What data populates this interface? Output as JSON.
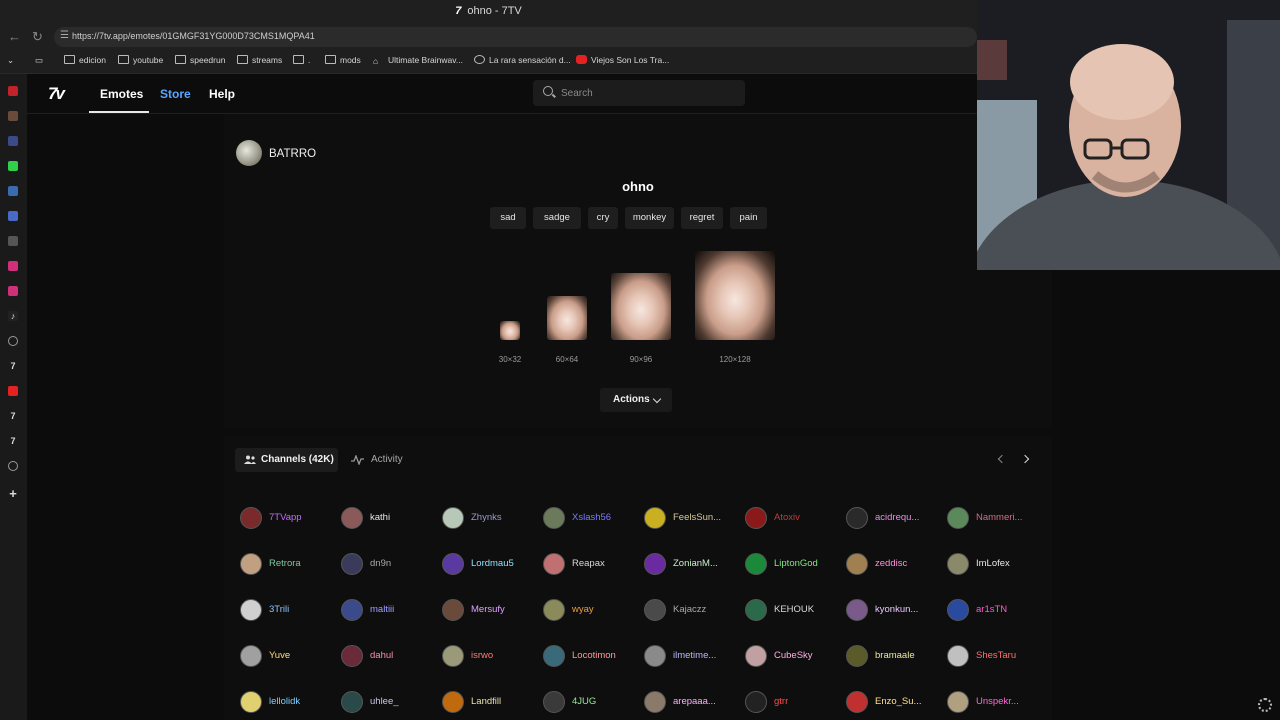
{
  "browser": {
    "window_title": "ohno - 7TV",
    "url": "https://7tv.app/emotes/01GMGF31YG000D73CMS1MQPA41",
    "bookmarks": [
      {
        "label": "edicion",
        "icon": "folder-icon"
      },
      {
        "label": "youtube",
        "icon": "folder-icon"
      },
      {
        "label": "speedrun",
        "icon": "folder-icon"
      },
      {
        "label": "streams",
        "icon": "folder-icon"
      },
      {
        "label": ".",
        "icon": "folder-icon"
      },
      {
        "label": "mods",
        "icon": "folder-icon"
      },
      {
        "label": "Ultimate Brainwav...",
        "icon": "mods-icon"
      },
      {
        "label": "La rara sensación d...",
        "icon": "globe-icon"
      },
      {
        "label": "Viejos Son Los Tra...",
        "icon": "youtube-icon"
      }
    ]
  },
  "site": {
    "logo": "7v",
    "nav": {
      "emotes": "Emotes",
      "store": "Store",
      "help": "Help"
    },
    "search_placeholder": "Search"
  },
  "emote": {
    "owner": "BATRRO",
    "name": "ohno",
    "tags": [
      "sad",
      "sadge",
      "cry",
      "monkey",
      "regret",
      "pain"
    ],
    "sizes": [
      "30×32",
      "60×64",
      "90×96",
      "120×128"
    ],
    "actions_label": "Actions"
  },
  "channels": {
    "tab_channels": "Channels (42K)",
    "tab_activity": "Activity",
    "list": [
      {
        "name": "7TVapp",
        "color": "#c66bff"
      },
      {
        "name": "kathi",
        "color": "#e8e8e8"
      },
      {
        "name": "Zhynks",
        "color": "#9a9ad6"
      },
      {
        "name": "Xslash56",
        "color": "#7b7bff"
      },
      {
        "name": "FeelsSun...",
        "color": "#d8c89a"
      },
      {
        "name": "Atoxiv",
        "color": "#c33a3a"
      },
      {
        "name": "acidrequ...",
        "color": "#e890e8"
      },
      {
        "name": "Nammeri...",
        "color": "#d06e88"
      },
      {
        "name": "Retrora",
        "color": "#7fc8a0"
      },
      {
        "name": "dn9n",
        "color": "#aaaaaa"
      },
      {
        "name": "Lordmau5",
        "color": "#8fe0ff"
      },
      {
        "name": "Reapax",
        "color": "#d8d8d8"
      },
      {
        "name": "ZonianM...",
        "color": "#c8f0c8"
      },
      {
        "name": "LiptonGod",
        "color": "#7fe87f"
      },
      {
        "name": "zeddisc",
        "color": "#ff8fd8"
      },
      {
        "name": "ImLofex",
        "color": "#e8e8e8"
      },
      {
        "name": "3Trili",
        "color": "#8ac4ff"
      },
      {
        "name": "maltiii",
        "color": "#a0a0ff"
      },
      {
        "name": "Mersufy",
        "color": "#e0a0ff"
      },
      {
        "name": "wyay",
        "color": "#e8a040"
      },
      {
        "name": "Kajaczz",
        "color": "#a8a8a8"
      },
      {
        "name": "KEHOUK",
        "color": "#d8d8d8"
      },
      {
        "name": "kyonkun...",
        "color": "#e8c8ff"
      },
      {
        "name": "ar1sTN",
        "color": "#ff5ad0"
      },
      {
        "name": "Yuve",
        "color": "#ffe070"
      },
      {
        "name": "dahul",
        "color": "#ff8fa8"
      },
      {
        "name": "isrwo",
        "color": "#ff7777"
      },
      {
        "name": "Locotimon",
        "color": "#ff9a9a"
      },
      {
        "name": "ilmetime...",
        "color": "#b8b8ff"
      },
      {
        "name": "CubeSky",
        "color": "#ffb0e0"
      },
      {
        "name": "bramaale",
        "color": "#e8e8a0"
      },
      {
        "name": "ShesTaru",
        "color": "#ff6f6f"
      },
      {
        "name": "lellolidk",
        "color": "#7fd0ff"
      },
      {
        "name": "uhlee_",
        "color": "#c8c8e8"
      },
      {
        "name": "Landfill",
        "color": "#e8e0b0"
      },
      {
        "name": "4JUG",
        "color": "#9ae89a"
      },
      {
        "name": "arepaaa...",
        "color": "#ffb0ff"
      },
      {
        "name": "gtrr",
        "color": "#ff4a4a"
      },
      {
        "name": "Enzo_Su...",
        "color": "#ffe08a"
      },
      {
        "name": "Unspekr...",
        "color": "#ff6ad8"
      }
    ]
  },
  "colors": {
    "accent_store": "#5aa7ff",
    "background": "#0c0c0c"
  }
}
